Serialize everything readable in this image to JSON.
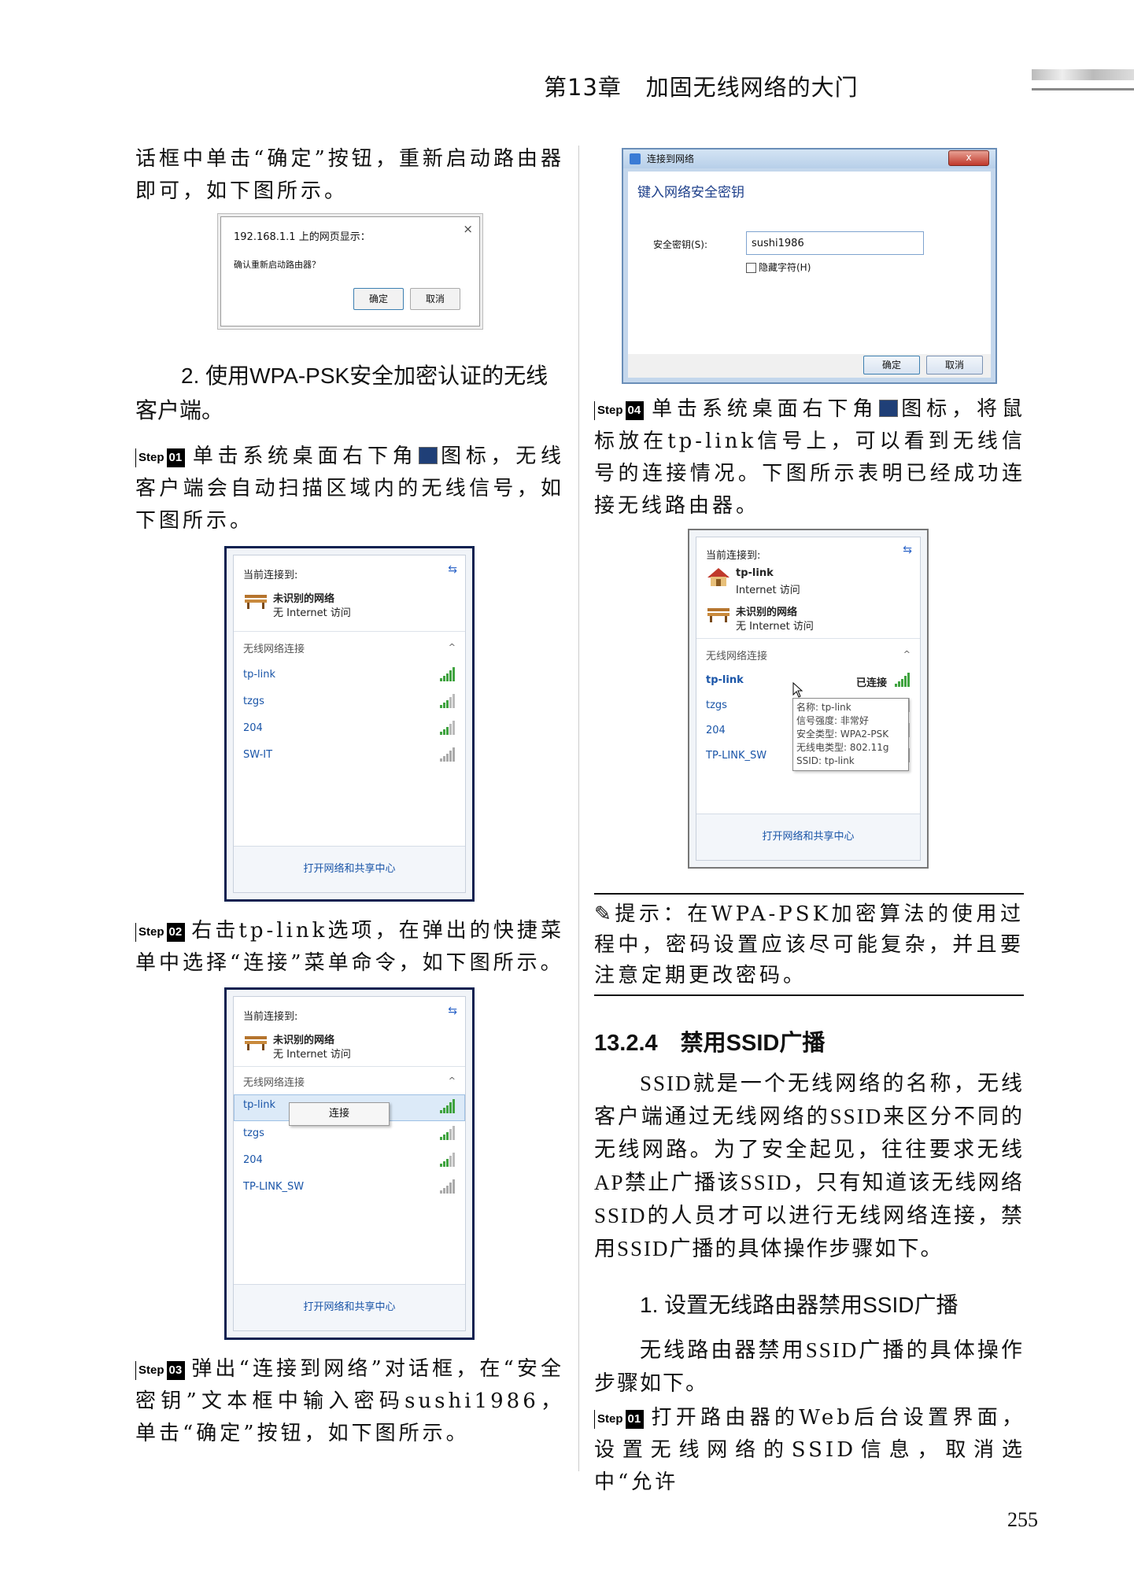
{
  "header": {
    "chapter": "第13章",
    "title": "加固无线网络的大门"
  },
  "left": {
    "p1": "话框中单击“确定”按钮，重新启动路由器即可，如下图所示。",
    "alert": {
      "title": "192.168.1.1 上的网页显示：",
      "message": "确认重新启动路由器？",
      "ok": "确定",
      "cancel": "取消",
      "close": "×"
    },
    "subheading": "2. 使用WPA-PSK安全加密认证的无线客户端。",
    "step1": {
      "badge_s": "Step",
      "badge_n": "01",
      "text_a": "单击系统桌面右下角",
      "text_b": "图标，无线客户端会自动扫描区域内的无线信号，如下图所示。"
    },
    "step2": {
      "badge_s": "Step",
      "badge_n": "02",
      "text": "右击tp-link选项，在弹出的快捷菜单中选择“连接”菜单命令，如下图所示。"
    },
    "step3": {
      "badge_s": "Step",
      "badge_n": "03",
      "text": "弹出“连接到网络”对话框，在“安全密钥”文本框中输入密码sushi1986，单击“确定”按钮，如下图所示。"
    }
  },
  "flyout1": {
    "current": "当前连接到:",
    "net_name": "未识别的网络",
    "net_status": "无 Internet 访问",
    "section": "无线网络连接",
    "networks": [
      "tp-link",
      "tzgs",
      "204",
      "SW-IT"
    ],
    "footer": "打开网络和共享中心"
  },
  "flyout2": {
    "current": "当前连接到:",
    "net_name": "未识别的网络",
    "net_status": "无 Internet 访问",
    "section": "无线网络连接",
    "networks": [
      "tp-link",
      "tzgs",
      "204",
      "TP-LINK_SW"
    ],
    "menu_item": "连接",
    "footer": "打开网络和共享中心"
  },
  "dialog": {
    "title": "连接到网络",
    "close": "x",
    "heading": "键入网络安全密钥",
    "key_label": "安全密钥(S):",
    "key_value": "sushi1986",
    "hide_label": "隐藏字符(H)",
    "ok": "确定",
    "cancel": "取消"
  },
  "right": {
    "step4": {
      "badge_s": "Step",
      "badge_n": "04",
      "text_a": "单击系统桌面右下角",
      "text_b": "图标，将鼠标放在tp-link信号上，可以看到无线信号的连接情况。下图所示表明已经成功连接无线路由器。"
    },
    "tip": "提示：在WPA-PSK加密算法的使用过程中，密码设置应该尽可能复杂，并且要注意定期更改密码。",
    "section": "13.2.4　禁用SSID广播",
    "p_ssid": "SSID就是一个无线网络的名称，无线客户端通过无线网络的SSID来区分不同的无线网路。为了安全起见，往往要求无线AP禁止广播该SSID，只有知道该无线网络SSID的人员才可以进行无线网络连接，禁用SSID广播的具体操作步骤如下。",
    "subheading": "1. 设置无线路由器禁用SSID广播",
    "p_steps": "无线路由器禁用SSID广播的具体操作步骤如下。",
    "step1": {
      "badge_s": "Step",
      "badge_n": "01",
      "text": "打开路由器的Web后台设置界面，设置无线网络的SSID信息，取消选中“允许"
    }
  },
  "flyout3": {
    "current": "当前连接到:",
    "net1_name": "tp-link",
    "net1_status": "Internet 访问",
    "net2_name": "未识别的网络",
    "net2_status": "无 Internet 访问",
    "section": "无线网络连接",
    "networks": [
      "tp-link",
      "tzgs",
      "204",
      "TP-LINK_SW"
    ],
    "connected": "已连接",
    "tooltip": [
      "名称: tp-link",
      "信号强度: 非常好",
      "安全类型: WPA2-PSK",
      "无线电类型: 802.11g",
      "SSID: tp-link"
    ],
    "footer": "打开网络和共享中心"
  },
  "page_number": "255"
}
